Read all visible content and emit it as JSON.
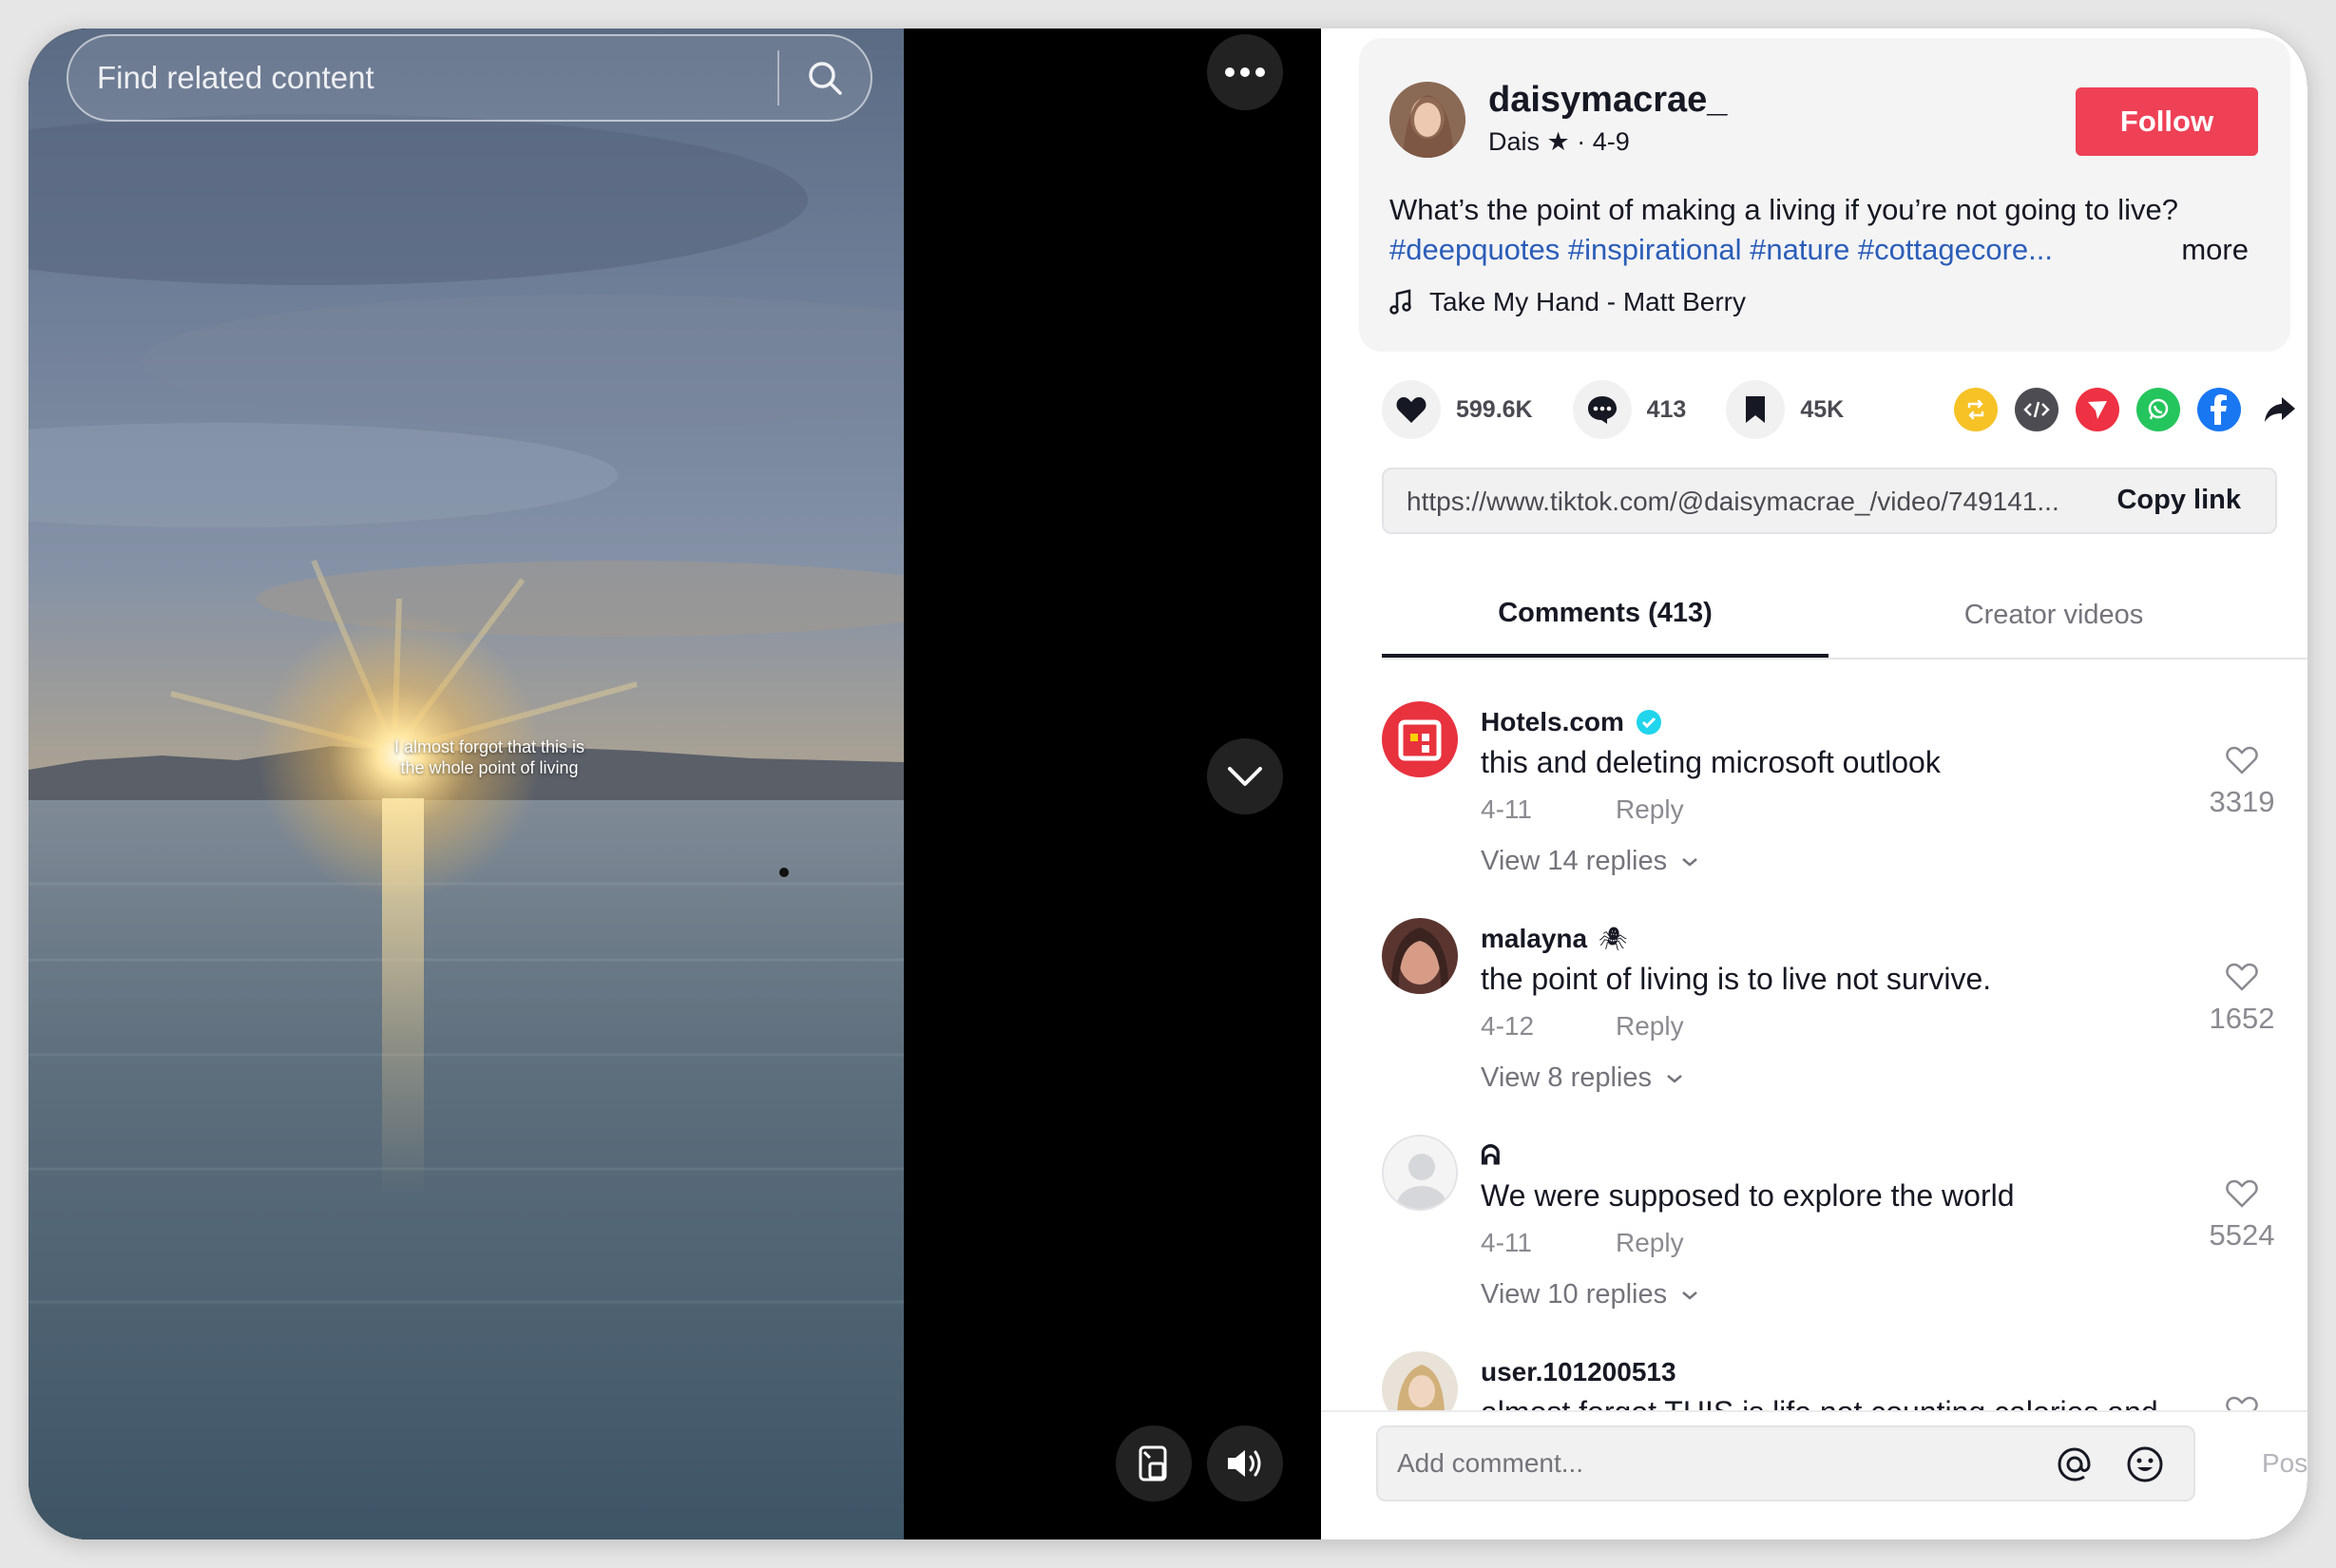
{
  "search": {
    "placeholder": "Find related content"
  },
  "video": {
    "overlay_text": "I almost forgot that this is the whole point of living"
  },
  "author": {
    "username": "daisymacrae_",
    "nickname_and_date": "Dais ★ · 4-9",
    "follow_label": "Follow"
  },
  "description": {
    "text": "What’s the point of making a living if you’re not going to live?",
    "hashtags": "#deepquotes #inspirational #nature #cottagecore...",
    "more_label": "more"
  },
  "music": {
    "title": "Take My Hand - Matt Berry"
  },
  "stats": {
    "likes": "599.6K",
    "comments": "413",
    "saves": "45K"
  },
  "share_icons": [
    "repost-icon",
    "embed-icon",
    "send-icon",
    "whatsapp-icon",
    "facebook-icon",
    "share-arrow-icon"
  ],
  "link": {
    "url": "https://www.tiktok.com/@daisymacrae_/video/749141...",
    "copy_label": "Copy link"
  },
  "tabs": [
    {
      "label": "Comments (413)",
      "active": true
    },
    {
      "label": "Creator videos",
      "active": false
    }
  ],
  "comments": [
    {
      "user": "Hotels.com",
      "verified": true,
      "text": "this and deleting microsoft outlook",
      "date": "4-11",
      "reply_label": "Reply",
      "replies_label": "View 14 replies",
      "likes": "3319"
    },
    {
      "user": "malayna",
      "user_suffix": "🕷",
      "text": "the point of living is to live not survive.",
      "date": "4-12",
      "reply_label": "Reply",
      "replies_label": "View 8 replies",
      "likes": "1652"
    },
    {
      "user": "ᕱ",
      "text": "We were supposed to explore the world",
      "date": "4-11",
      "reply_label": "Reply",
      "replies_label": "View 10 replies",
      "likes": "5524"
    },
    {
      "user": "user.101200513",
      "text": "almost forgot THIS is life not counting calories and",
      "date": "",
      "reply_label": "",
      "replies_label": "",
      "likes": ""
    }
  ],
  "composer": {
    "placeholder": "Add comment...",
    "post_label": "Post"
  },
  "colors": {
    "follow": "#ee4156",
    "hashtag": "#2b5db9",
    "repost": "#f6c226",
    "embed": "#4c4c52",
    "send": "#ee3143",
    "whatsapp": "#25c55d",
    "facebook": "#1977f2",
    "verified": "#20d5ec"
  }
}
